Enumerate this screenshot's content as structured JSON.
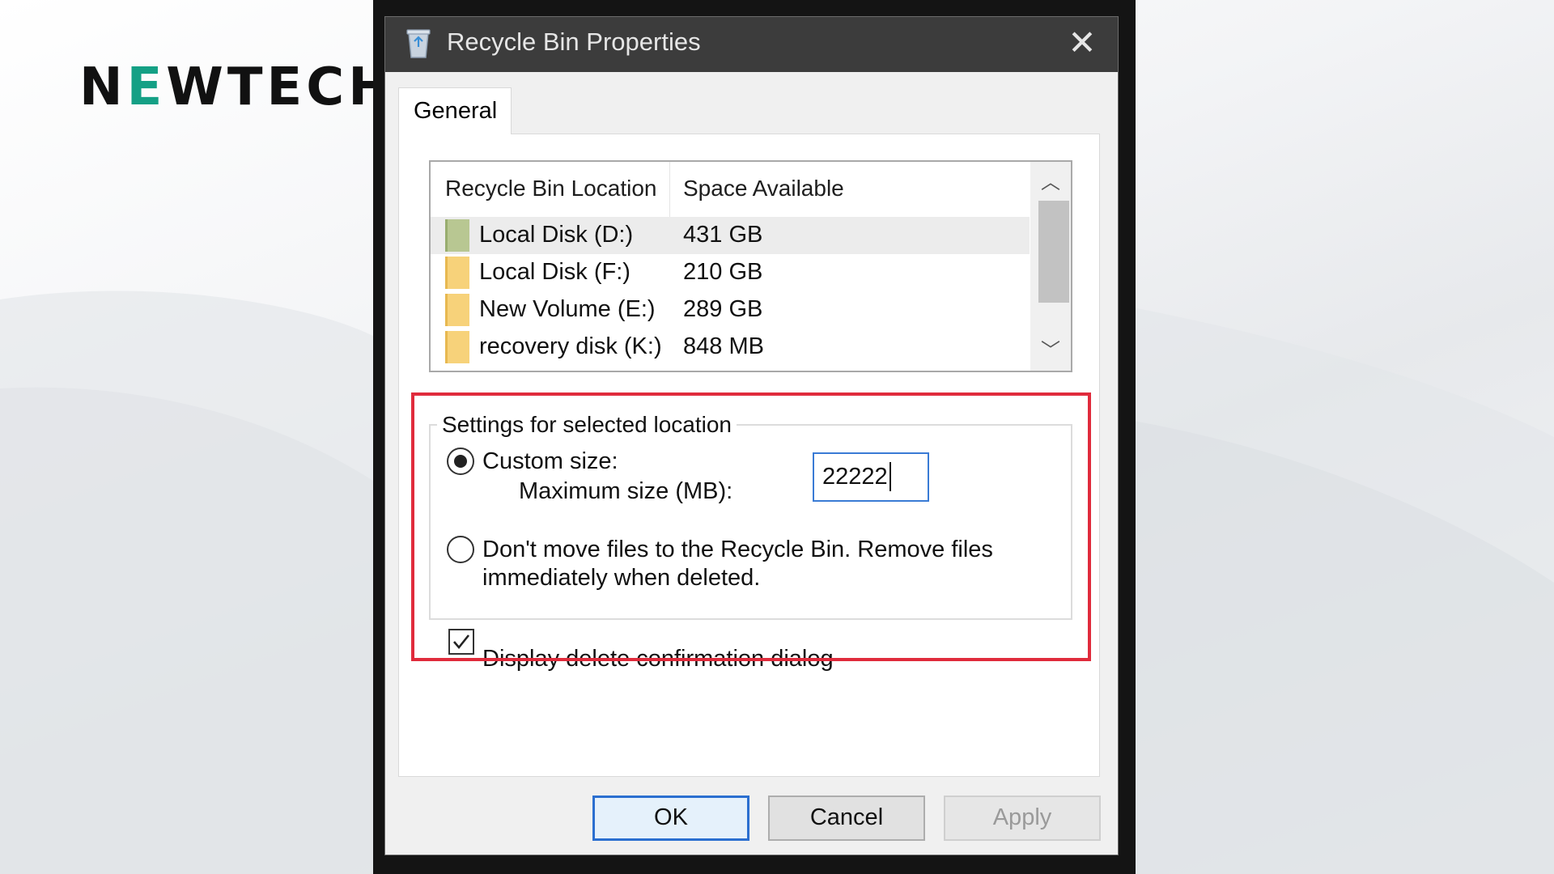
{
  "logo": {
    "prefix": "N",
    "accent": "E",
    "suffix": "WTECH"
  },
  "dialog": {
    "title": "Recycle Bin Properties",
    "close_glyph": "✕",
    "tabs": [
      {
        "label": "General"
      }
    ],
    "list": {
      "columns": [
        "Recycle Bin Location",
        "Space Available"
      ],
      "rows": [
        {
          "name": "Local Disk (D:)",
          "space": "431 GB",
          "selected": true
        },
        {
          "name": "Local Disk (F:)",
          "space": "210 GB",
          "selected": false
        },
        {
          "name": "New Volume (E:)",
          "space": "289 GB",
          "selected": false
        },
        {
          "name": "recovery disk (K:)",
          "space": "848 MB",
          "selected": false
        }
      ],
      "scroll_up_glyph": "︿",
      "scroll_down_glyph": "﹀"
    },
    "settings": {
      "legend": "Settings for selected location",
      "custom_size_label": "Custom size:",
      "custom_size_selected": true,
      "max_size_label": "Maximum size (MB):",
      "max_size_value": "22222",
      "dont_move_line1": "Don't move files to the Recycle Bin. Remove files",
      "dont_move_line2": "immediately when deleted.",
      "dont_move_selected": false,
      "confirm_label": "Display delete confirmation dialog",
      "confirm_checked": true
    },
    "buttons": {
      "ok": "OK",
      "cancel": "Cancel",
      "apply": "Apply"
    }
  },
  "colors": {
    "highlight": "#e02b3c",
    "logo_accent": "#14a085",
    "titlebar": "#3c3c3c",
    "focus_blue": "#2b6fd0"
  }
}
